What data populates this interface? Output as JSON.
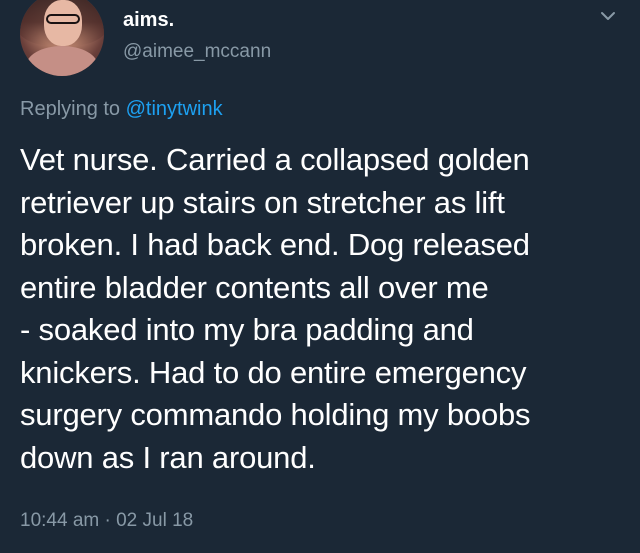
{
  "tweet": {
    "author": {
      "display_name": "aims.",
      "handle": "@aimee_mccann",
      "avatar": "profile-photo"
    },
    "reply_context": {
      "prefix": "Replying to ",
      "mention": "@tinytwink"
    },
    "text": "Vet nurse. Carried a collapsed golden\nretriever up stairs on stretcher as lift\nbroken. I had back end. Dog released\nentire bladder contents all over me\n- soaked into my bra padding and\nknickers. Had to do entire emergency\nsurgery commando holding my boobs\ndown as I ran around.",
    "timestamp": "10:44 am · 02 Jul 18",
    "menu_icon": "chevron-down-icon"
  },
  "colors": {
    "background": "#1b2836",
    "primary_text": "#ffffff",
    "secondary_text": "#8899a6",
    "link": "#1da1f2"
  }
}
